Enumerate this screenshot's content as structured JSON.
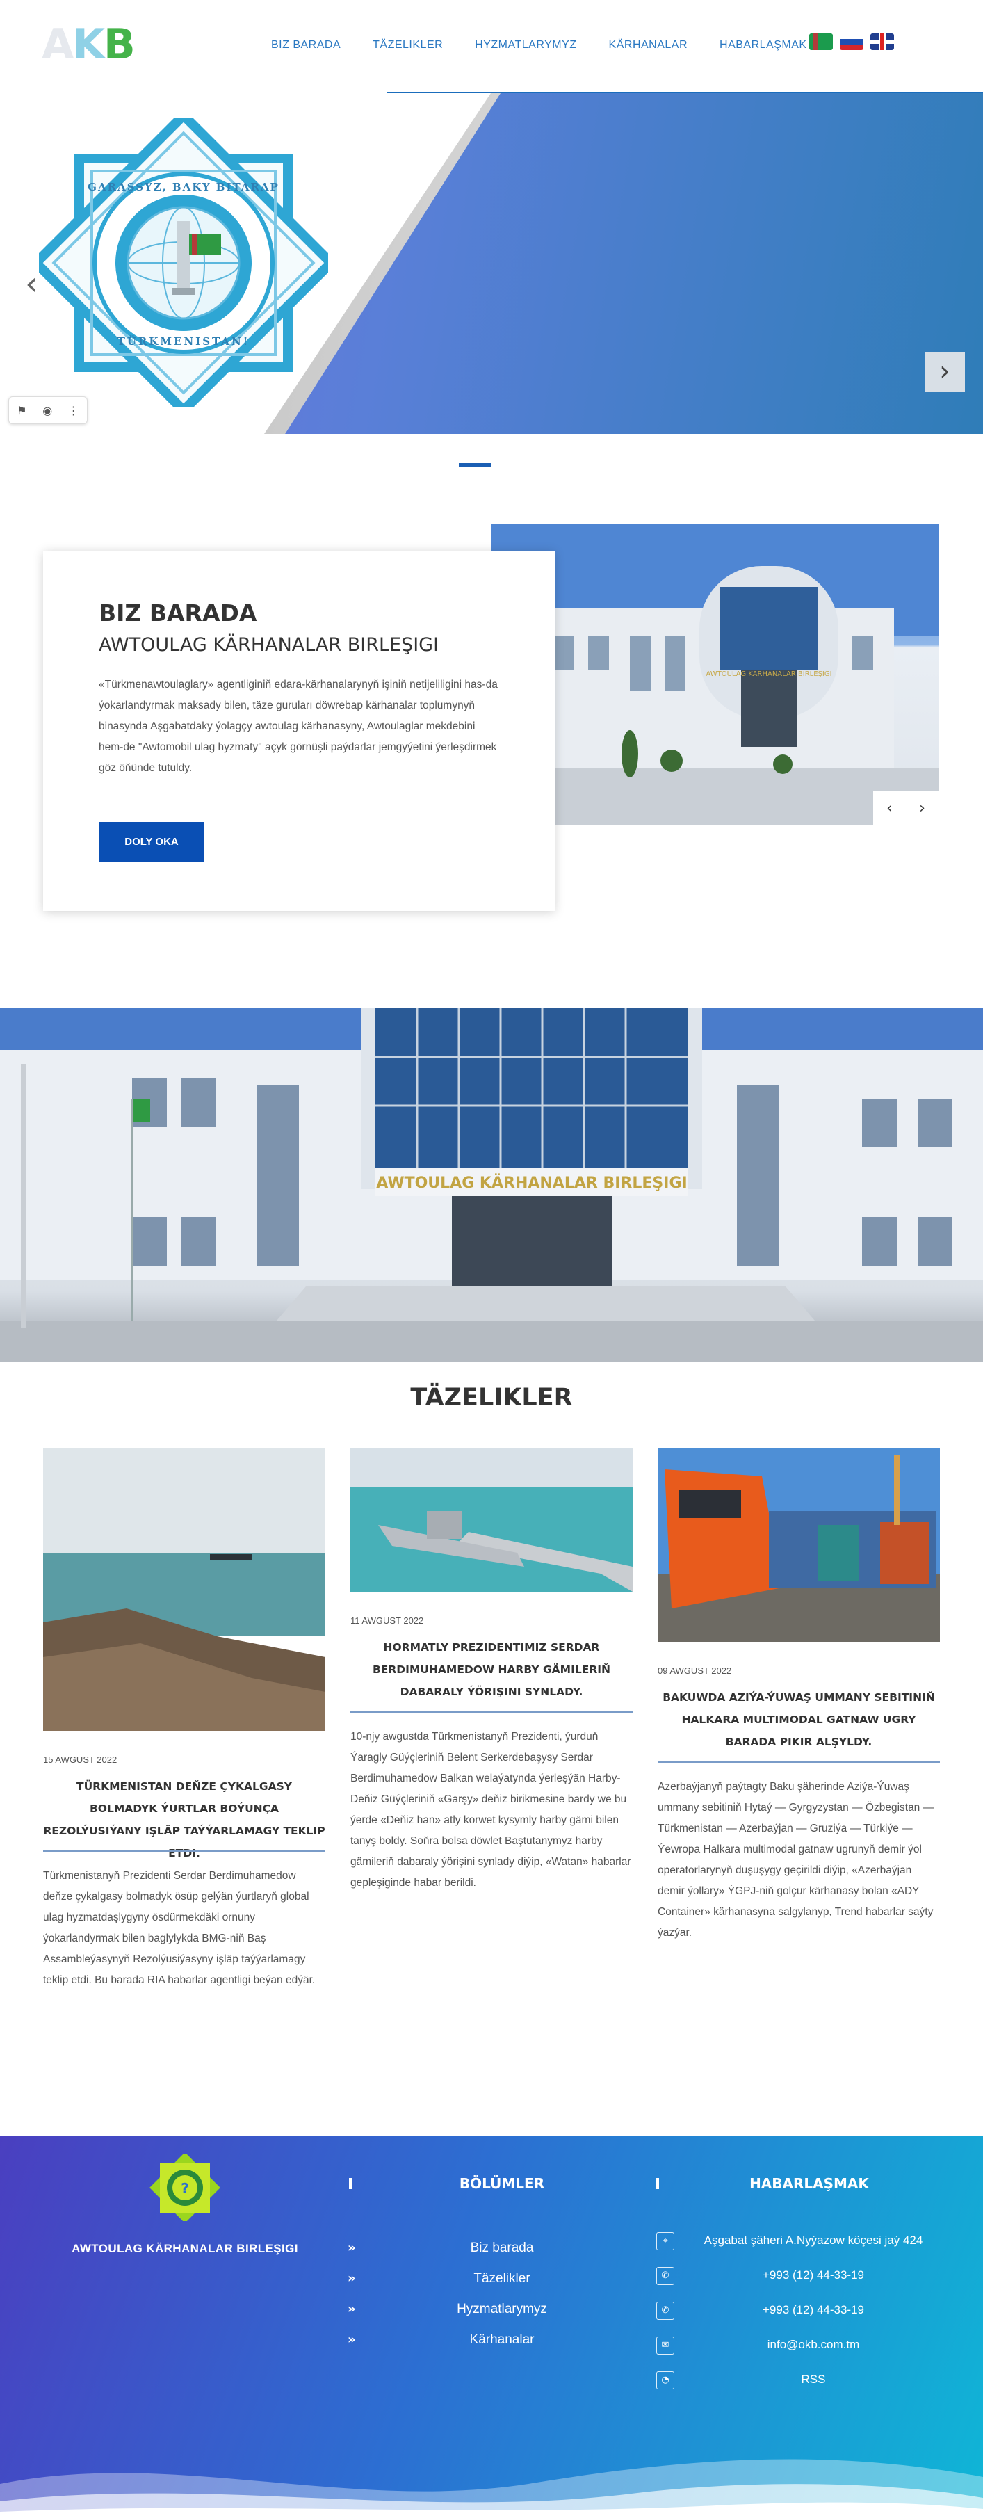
{
  "header": {
    "logo": {
      "a": "A",
      "k": "K",
      "b": "B"
    },
    "nav": [
      "BIZ BARADA",
      "TÄZELIKLER",
      "HYZMATLARYMYZ",
      "KÄRHANALAR",
      "HABARLAŞMAK"
    ],
    "flags": [
      "flag-turkmenistan",
      "flag-russia",
      "flag-uk"
    ]
  },
  "hero": {
    "emblem_text_top": "GARAŞSYZ, BAKY BITARAP",
    "emblem_text_bottom": "TÜRKMENISTAN!",
    "prev_icon": "chevron-left-icon",
    "next_icon": "chevron-right-icon",
    "toolbar_icons": [
      "bookmark-icon",
      "camera-icon",
      "more-vertical-icon"
    ],
    "colors": {
      "accent": "#1a5fb4",
      "gradient_start": "#6f6ee0",
      "gradient_end": "#2f7db8"
    }
  },
  "about": {
    "title": "BIZ BARADA",
    "subtitle": "AWTOULAG KÄRHANALAR BIRLEŞIGI",
    "text": "«Türkmenawtoulaglary» agentliginiň edara-kärhanalarynyň işiniň netijeliligini has-da ýokarlandyrmak maksady bilen, täze guruları döwrebap kärhanalar toplumynyň binasynda Aşgabatdaky ýolagçy awtoulag kärhanasyny, Awtoulaglar mekdebini hem-de \"Awtomobil ulag hyzmaty\" açyk görnüşli paýdarlar jemgyýetini ýerleşdirmek göz öňünde tutuldy.",
    "button": "DOLY OKA",
    "building_sign": "AWTOULAG KÄRHANALAR BIRLEŞIGI"
  },
  "banner": {
    "building_sign": "AWTOULAG KÄRHANALAR BIRLEŞIGI"
  },
  "news": {
    "heading": "TÄZELIKLER",
    "items": [
      {
        "date": "15 AWGUST 2022",
        "title": "TÜRKMENISTAN DEŇZE ÇYKALGASY BOLMADYK ÝURTLAR BOÝUNÇA REZOLÝUSIÝANY IŞLÄP TAÝÝARLAMAGY TEKLIP ETDI.",
        "body": "Türkmenistanyň Prezidenti Serdar Berdimuhamedow deňze çykalgasy bolmadyk ösüp gelýän ýurtlaryň global ulag hyzmatdaşlygyny ösdürmekdäki ornuny ýokarlandyrmak bilen baglylykda BMG-niň Baş Assambleýasynyň Rezolýusiýasyny işläp taýýarlamagy teklip etdi. Bu barada RIA habarlar agentligi beýan edýär."
      },
      {
        "date": "11 AWGUST 2022",
        "title": "HORMATLY PREZIDENTIMIZ SERDAR BERDIMUHAMEDOW HARBY GÄMILERIŇ DABARALY ÝÖRIŞINI SYNLADY.",
        "body": "10-njy awgustda Türkmenistanyň Prezidenti, ýurduň Ýaragly Güýçleriniň Belent Serkerdebaşysy Serdar Berdimuhamedow Balkan welaýatynda ýerleşýän Harby-Deňiz Güýçleriniň «Garşy» deňiz birikmesine bardy we bu ýerde «Deňiz han» atly korwet kysymly harby gämi bilen tanyş boldy. Soňra bolsa döwlet Baştutanymyz harby gämileriň dabaraly ýörişini synlady diýip, «Watan» habarlar gepleşiginde habar berildi."
      },
      {
        "date": "09 AWGUST 2022",
        "title": "BAKUWDA AZIÝA-ÝUWAŞ UMMANY SEBITINIŇ HALKARA MULTIMODAL GATNAW UGRY BARADA PIKIR ALŞYLDY.",
        "body": "Azerbaýjanyň paýtagty Baku şäherinde Aziýa-Ýuwaş ummany sebitiniň Hytaý — Gyrgyzystan — Özbegistan — Türkmenistan — Azerbaýjan — Gruziýa — Türkiýe — Ýewropa Halkara multimodal gatnaw ugrunyň demir ýol operatorlarynyň duşuşygy geçirildi diýip, «Azerbaýjan demir ýollary» ÝGPJ-niň golçur kärhanasy bolan «ADY Container» kärhanasyna salgylanyp, Trend habarlar saýty ýazýar."
      }
    ]
  },
  "footer": {
    "org_name": "AWTOULAG KÄRHANALAR BIRLEŞIGI",
    "sections_heading": "BÖLÜMLER",
    "sections": [
      "Biz barada",
      "Täzelikler",
      "Hyzmatlarymyz",
      "Kärhanalar"
    ],
    "contact_heading": "HABARLAŞMAK",
    "contacts": [
      {
        "icon": "location-icon",
        "text": "Aşgabat şäheri A.Nyýazow köçesi jaý 424"
      },
      {
        "icon": "phone-icon",
        "text": "+993 (12) 44-33-19"
      },
      {
        "icon": "phone-icon",
        "text": "+993 (12) 44-33-19"
      },
      {
        "icon": "mail-icon",
        "text": "info@okb.com.tm"
      },
      {
        "icon": "rss-icon",
        "text": "RSS"
      }
    ]
  }
}
